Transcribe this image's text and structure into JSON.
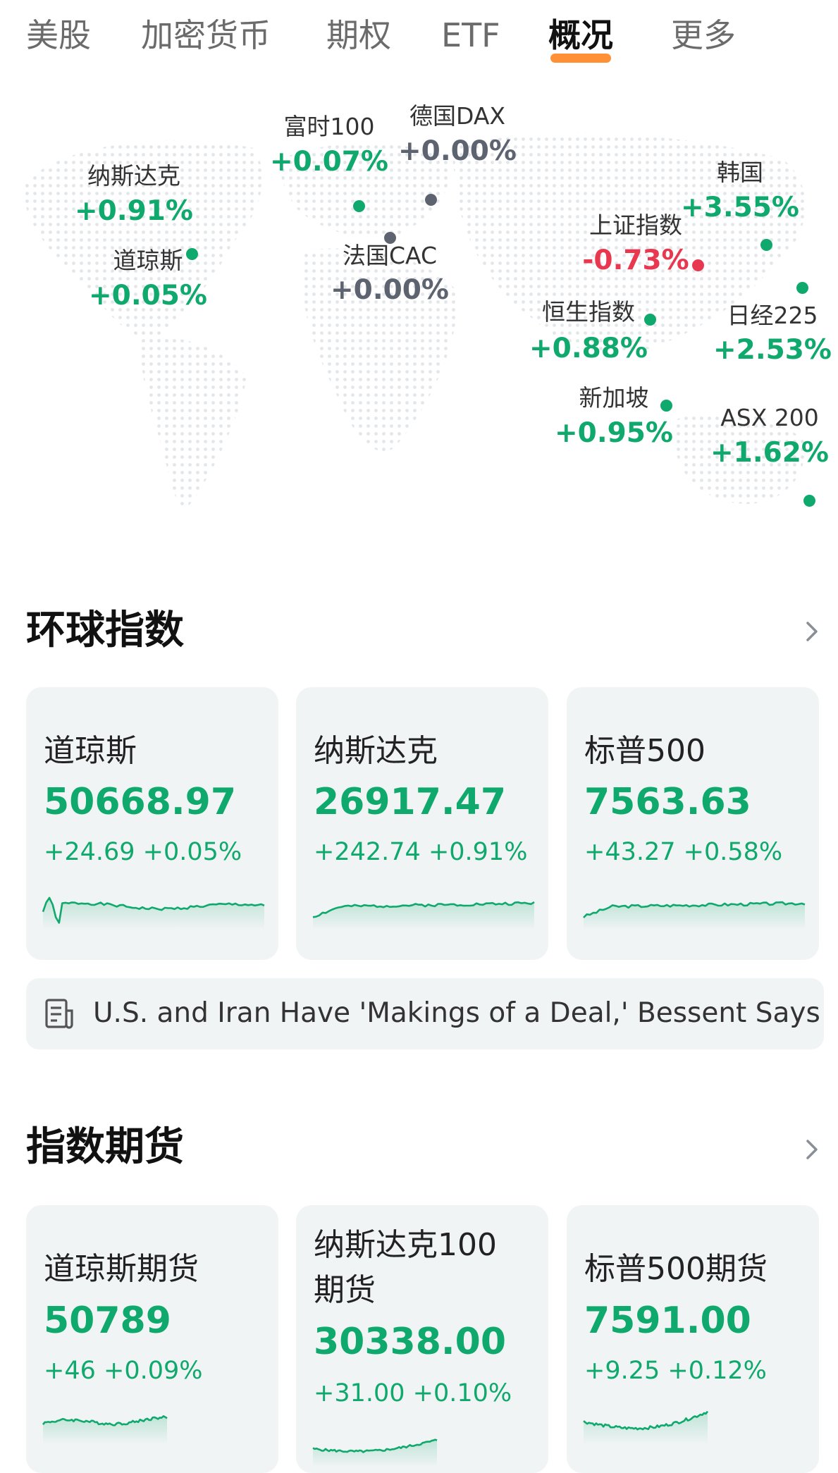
{
  "tabs": [
    "美股",
    "加密货币",
    "期权",
    "ETF",
    "概况",
    "更多"
  ],
  "active_tab": "概况",
  "colors": {
    "up": "#0fa96d",
    "down": "#e8384f",
    "flat": "#5d6470",
    "accent": "#ff8a2b"
  },
  "map_markets": [
    {
      "name": "纳斯达克",
      "change": "+0.91%",
      "trend": "up"
    },
    {
      "name": "道琼斯",
      "change": "+0.05%",
      "trend": "up"
    },
    {
      "name": "富时100",
      "change": "+0.07%",
      "trend": "up"
    },
    {
      "name": "德国DAX",
      "change": "+0.00%",
      "trend": "flat"
    },
    {
      "name": "法国CAC",
      "change": "+0.00%",
      "trend": "flat"
    },
    {
      "name": "上证指数",
      "change": "-0.73%",
      "trend": "down"
    },
    {
      "name": "韩国",
      "change": "+3.55%",
      "trend": "up"
    },
    {
      "name": "日经225",
      "change": "+2.53%",
      "trend": "up"
    },
    {
      "name": "恒生指数",
      "change": "+0.88%",
      "trend": "up"
    },
    {
      "name": "新加坡",
      "change": "+0.95%",
      "trend": "up"
    },
    {
      "name": "ASX 200",
      "change": "+1.62%",
      "trend": "up"
    }
  ],
  "global_indices": {
    "title": "环球指数",
    "cards": [
      {
        "name": "道琼斯",
        "price": "50668.97",
        "change": "+24.69",
        "percent": "+0.05%"
      },
      {
        "name": "纳斯达克",
        "price": "26917.47",
        "change": "+242.74",
        "percent": "+0.91%"
      },
      {
        "name": "标普500",
        "price": "7563.63",
        "change": "+43.27",
        "percent": "+0.58%"
      }
    ]
  },
  "news": {
    "text": "U.S. and Iran Have 'Makings of a Deal,' Bessent Says",
    "icon": "news-icon"
  },
  "index_futures": {
    "title": "指数期货",
    "cards": [
      {
        "name": "道琼斯期货",
        "price": "50789",
        "change": "+46",
        "percent": "+0.09%"
      },
      {
        "name": "纳斯达克100",
        "name_line2": "期货",
        "price": "30338.00",
        "change": "+31.00",
        "percent": "+0.10%"
      },
      {
        "name": "标普500期货",
        "price": "7591.00",
        "change": "+9.25",
        "percent": "+0.12%"
      }
    ]
  }
}
